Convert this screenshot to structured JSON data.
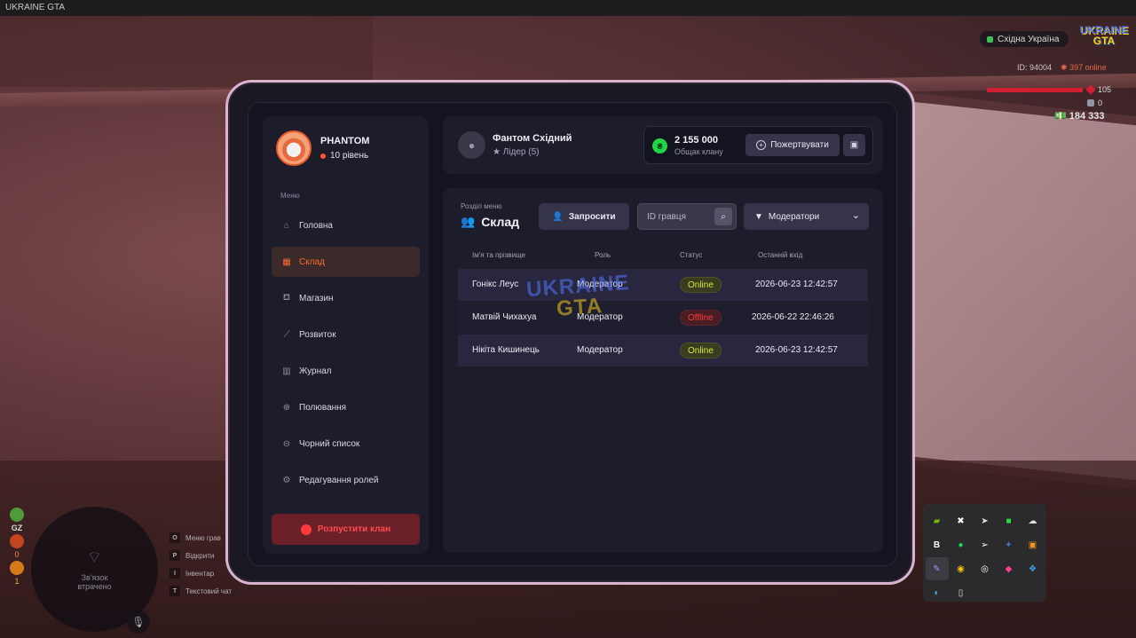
{
  "window": {
    "title": "UKRAINE GTA"
  },
  "hud": {
    "server": "Східна Україна",
    "logo": {
      "line1": "UKRAINE",
      "line2": "GTA"
    },
    "id_label": "ID: 94004",
    "online_label": "397 online",
    "health": "105",
    "armor": "0",
    "money": "184 333",
    "health_fraction": 1.0,
    "colors": {
      "health": "#d01f32",
      "online": "#e86a4a"
    }
  },
  "minimap": {
    "status_line1": "Зв'язок",
    "status_line2": "втрачено"
  },
  "side_stats": {
    "label1": "GZ",
    "val1": "0",
    "val2": "1"
  },
  "keybinds": [
    {
      "key": "O",
      "label": "Меню грав"
    },
    {
      "key": "P",
      "label": "Відкрити"
    },
    {
      "key": "I",
      "label": "Інвентар"
    },
    {
      "key": "T",
      "label": "Текстовий чат"
    }
  ],
  "clan_panel": {
    "profile": {
      "name": "PHANTOM",
      "level": "10 рівень"
    },
    "menu_caption": "Меню",
    "nav": [
      {
        "icon": "home-icon",
        "label": "Головна",
        "active": false
      },
      {
        "icon": "warehouse-icon",
        "label": "Склад",
        "active": true
      },
      {
        "icon": "shop-basket-icon",
        "label": "Магазин",
        "active": false
      },
      {
        "icon": "chart-line-icon",
        "label": "Розвиток",
        "active": false
      },
      {
        "icon": "book-icon",
        "label": "Журнал",
        "active": false
      },
      {
        "icon": "crosshair-icon",
        "label": "Полювання",
        "active": false
      },
      {
        "icon": "blacklist-icon",
        "label": "Чорний список",
        "active": false
      },
      {
        "icon": "user-gear-icon",
        "label": "Редагування ролей",
        "active": false
      }
    ],
    "disband_button": "Розпустити клан",
    "leader": {
      "name": "Фантом Східний",
      "rank": "Лідер (5)"
    },
    "bank": {
      "amount": "2 155 000",
      "label": "Общак клану",
      "donate_button": "Пожертвувати"
    },
    "section": {
      "caption": "Розділ меню",
      "title": "Склад",
      "invite_button": "Запросити",
      "search_placeholder": "ID гравця",
      "filter_selected": "Модератори"
    },
    "table": {
      "headers": [
        "Ім'я та прізвище",
        "Роль",
        "Статус",
        "Останній вхід"
      ],
      "rows": [
        {
          "name": "Гонікс Леус",
          "role": "Модератор",
          "status": "Online",
          "last_login": "2026-06-23 12:42:57"
        },
        {
          "name": "Матвій Чихахуа",
          "role": "Модератор",
          "status": "Offline",
          "last_login": "2026-06-22 22:46:26"
        },
        {
          "name": "Нікіта Кишинець",
          "role": "Модератор",
          "status": "Online",
          "last_login": "2026-06-23 12:42:57"
        }
      ]
    },
    "watermark": {
      "line1": "UKRAINE",
      "line2": "GTA"
    },
    "colors": {
      "accent": "#ff6a2a",
      "online": "#d6e83a",
      "offline": "#ff3b3b",
      "bank_coin": "#23d446",
      "frame": "#d8b4cf"
    }
  },
  "tray_icons": [
    "nvidia-icon",
    "app-icon",
    "steam-icon",
    "green-app-icon",
    "cloud-icon",
    "b-app-icon",
    "spotify-icon",
    "telegram-icon",
    "app-blue-icon",
    "orange-app-icon",
    "feather-icon",
    "chrome-icon",
    "discord-icon",
    "pink-app-icon",
    "colorful-app-icon",
    "edge-icon",
    "usb-icon"
  ]
}
